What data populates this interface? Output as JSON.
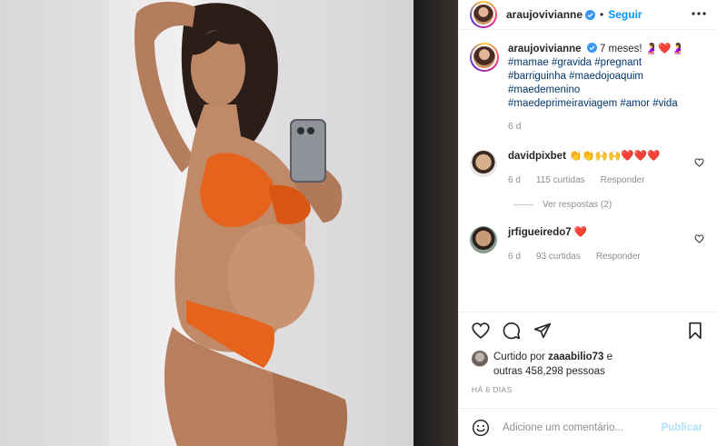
{
  "post": {
    "username": "araujovivianne",
    "follow_label": "Seguir",
    "separator": "•",
    "caption_text": "7 meses! 🤰❤️🤰",
    "hashtags": [
      "#mamae",
      "#gravida",
      "#pregnant",
      "#barriguinha",
      "#maedojoaquim",
      "#maedemenino",
      "#maedeprimeiraviagem",
      "#amor",
      "#vida"
    ],
    "caption_time": "6 d"
  },
  "comments": [
    {
      "username": "davidpixbet",
      "text": "👏👏🙌🙌❤️❤️❤️",
      "time": "6 d",
      "likes": "115 curtidas",
      "reply_label": "Responder",
      "view_replies": "Ver respostas (2)"
    },
    {
      "username": "jrfigueiredo7",
      "text": "❤️",
      "time": "6 d",
      "likes": "93 curtidas",
      "reply_label": "Responder"
    }
  ],
  "likes": {
    "prefix": "Curtido por",
    "user": "zaaabilio73",
    "middle": "e",
    "others": "outras 458,298 pessoas"
  },
  "posted_ago": "HÁ 6 DIAS",
  "comment_box": {
    "placeholder": "Adicione um comentário...",
    "post_label": "Publicar"
  },
  "icons": {
    "more": "more-dots-icon",
    "verified": "verified-badge-icon",
    "like": "heart-icon",
    "comment": "comment-bubble-icon",
    "share": "paper-plane-icon",
    "save": "bookmark-icon",
    "emoji": "smiley-icon"
  },
  "colors": {
    "accent": "#0095f6",
    "hashtag": "#00376b",
    "heart": "#ed4956",
    "muted": "#8e8e8e",
    "publish_disabled": "#b2dffc"
  }
}
